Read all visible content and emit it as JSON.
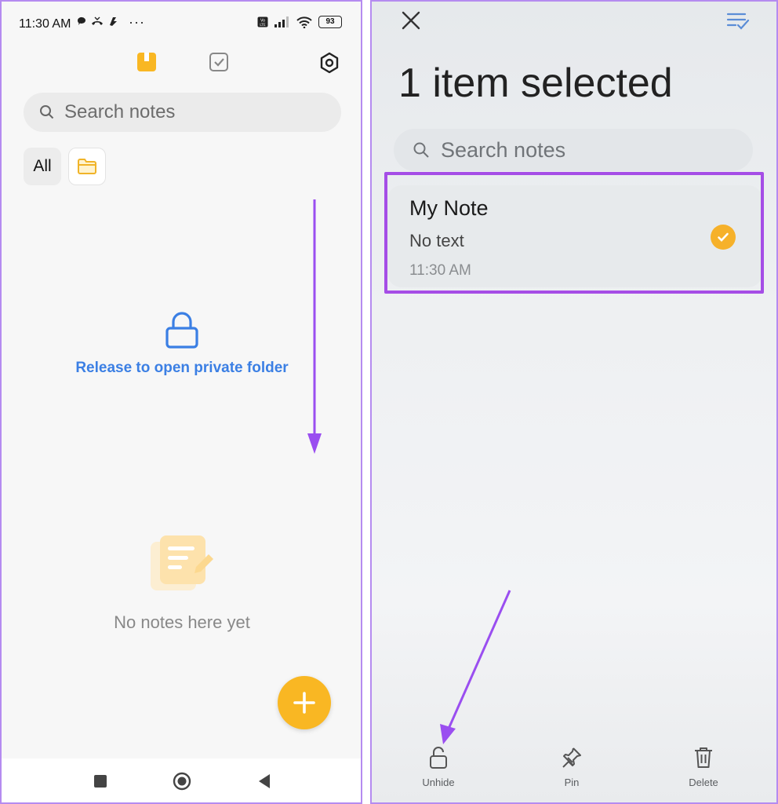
{
  "colors": {
    "accent_yellow": "#f9b723",
    "private_blue": "#3b7fe4",
    "highlight_purple": "#a54de6",
    "annotation_arrow": "#9a4ef0"
  },
  "left_screen": {
    "status_bar": {
      "time": "11:30 AM",
      "more": "···",
      "battery": "93"
    },
    "top_icons": [
      "notes-icon",
      "tasks-icon",
      "settings-icon"
    ],
    "search": {
      "placeholder": "Search notes"
    },
    "filters": {
      "all_label": "All",
      "folder_icon": "folder-icon"
    },
    "private_folder": {
      "message": "Release to open private folder",
      "icon": "lock-icon"
    },
    "empty_state": {
      "message": "No notes here yet",
      "icon": "empty-notes-icon"
    },
    "fab": {
      "icon": "plus-icon"
    },
    "nav": [
      "recents-icon",
      "home-icon",
      "back-icon"
    ]
  },
  "right_screen": {
    "header": {
      "close_icon": "close-icon",
      "select_all_icon": "select-all-icon",
      "title": "1 item selected"
    },
    "search": {
      "placeholder": "Search notes"
    },
    "notes": [
      {
        "title": "My Note",
        "subtitle": "No text",
        "time": "11:30 AM",
        "selected": true
      }
    ],
    "actions": [
      {
        "label": "Unhide",
        "icon": "unlock-icon"
      },
      {
        "label": "Pin",
        "icon": "pin-icon"
      },
      {
        "label": "Delete",
        "icon": "trash-icon"
      }
    ]
  }
}
